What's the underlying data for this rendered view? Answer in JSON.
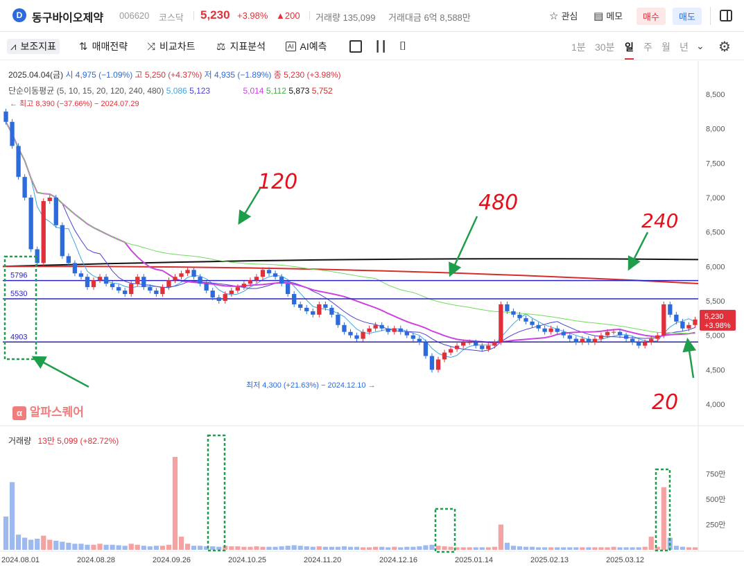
{
  "header": {
    "logo_letter": "D",
    "name": "동구바이오제약",
    "code": "006620",
    "market": "코스닥",
    "price": "5,230",
    "change_pct": "+3.98%",
    "change_abs": "▲200",
    "volume": "거래량 135,099",
    "amount": "거래대금 6억 8,588만",
    "watch_label": "관심",
    "memo_label": "메모",
    "buy_label": "매수",
    "sell_label": "매도"
  },
  "toolbar": {
    "indicator_label": "보조지표",
    "strategy_label": "매매전략",
    "compare_label": "비교차트",
    "analysis_label": "지표분석",
    "ai_label": "AI예측",
    "periods": [
      "1분",
      "30분",
      "일",
      "주",
      "월",
      "년"
    ],
    "selected_period": "일"
  },
  "chart_data": {
    "type": "candlestick",
    "ohlc_label": {
      "date": "2025.04.04(금)",
      "open": "시 4,975 (−1.09%)",
      "high": "고 5,250 (+4.37%)",
      "low": "저 4,935 (−1.89%)",
      "close": "종 5,230 (+3.98%)"
    },
    "ma_label": "단순이동평균 (5, 10, 15, 20, 120, 240, 480)",
    "ma_values": [
      {
        "period": 5,
        "value": "5,086",
        "color": "#3aa6e6"
      },
      {
        "period": 10,
        "value": "5,123",
        "color": "#4b3fd1"
      },
      {
        "period": 15,
        "value": "",
        "color": "#bbbbbb"
      },
      {
        "period": 20,
        "value": "5,014",
        "color": "#cc44dd"
      },
      {
        "period": 120,
        "value": "5,112",
        "color": "#5ad84a"
      },
      {
        "period": 240,
        "value": "5,873",
        "color": "#111111"
      },
      {
        "period": 480,
        "value": "5,752",
        "color": "#d62d2d"
      }
    ],
    "high_note": "← 최고 8,390 (−37.66%) − 2024.07.29",
    "low_note": "최저 4,300 (+21.63%) − 2024.12.10 →",
    "y_ticks": [
      "8,500",
      "8,000",
      "7,500",
      "7,000",
      "6,500",
      "6,000",
      "5,500",
      "5,000",
      "4,500",
      "4,000"
    ],
    "y_range": [
      4000,
      8500
    ],
    "x_ticks": [
      "2024.08.01",
      "2024.08.28",
      "2024.09.26",
      "2024.10.25",
      "2024.11.20",
      "2024.12.16",
      "2025.01.14",
      "2025.02.13",
      "2025.03.12"
    ],
    "last_price_badge": "5,230",
    "last_change_badge": "+3.98%",
    "horizontal_lines": [
      {
        "label": "5796",
        "value": 5796
      },
      {
        "label": "5530",
        "value": 5530
      },
      {
        "label": "4903",
        "value": 4903
      }
    ],
    "annotations": [
      "120",
      "480",
      "240",
      "20"
    ],
    "watermark": "알파스퀘어",
    "volume_label": "거래량",
    "volume_value": "13만 5,099 (+82.72%)",
    "volume_ticks": [
      "750만",
      "500만",
      "250만"
    ],
    "closes": [
      8100,
      7750,
      7300,
      7000,
      6250,
      6050,
      6950,
      7000,
      6600,
      6150,
      6050,
      5900,
      5850,
      5700,
      5800,
      5850,
      5750,
      5700,
      5650,
      5600,
      5750,
      5850,
      5700,
      5650,
      5600,
      5700,
      5800,
      5850,
      5900,
      5950,
      5850,
      5750,
      5650,
      5550,
      5500,
      5600,
      5650,
      5700,
      5750,
      5800,
      5850,
      5950,
      5900,
      5850,
      5750,
      5600,
      5450,
      5400,
      5350,
      5300,
      5450,
      5400,
      5300,
      5150,
      5050,
      5000,
      4950,
      5050,
      5100,
      5150,
      5100,
      5050,
      5100,
      5050,
      5000,
      4950,
      4900,
      4700,
      4500,
      4650,
      4750,
      4800,
      4850,
      4900,
      4900,
      4850,
      4800,
      4850,
      4900,
      5450,
      5350,
      5300,
      5250,
      5200,
      5150,
      5100,
      5050,
      5100,
      5050,
      5000,
      4950,
      4900,
      4950,
      4900,
      4950,
      5000,
      5050,
      5050,
      5000,
      4950,
      4900,
      4850,
      4900,
      4950,
      5000,
      5450,
      5300,
      5200,
      5100,
      5150,
      5230
    ],
    "volumes": [
      330,
      670,
      150,
      120,
      100,
      110,
      140,
      100,
      90,
      80,
      70,
      60,
      60,
      50,
      50,
      60,
      50,
      50,
      45,
      40,
      60,
      50,
      40,
      35,
      40,
      40,
      50,
      920,
      130,
      60,
      40,
      40,
      35,
      35,
      30,
      40,
      35,
      35,
      30,
      30,
      35,
      30,
      30,
      30,
      35,
      40,
      45,
      40,
      35,
      30,
      35,
      30,
      30,
      30,
      35,
      30,
      30,
      25,
      25,
      30,
      30,
      25,
      30,
      25,
      30,
      30,
      35,
      45,
      50,
      40,
      35,
      30,
      25,
      25,
      25,
      25,
      25,
      25,
      30,
      250,
      70,
      40,
      35,
      30,
      30,
      25,
      25,
      25,
      25,
      25,
      25,
      25,
      25,
      25,
      25,
      25,
      25,
      30,
      25,
      25,
      25,
      25,
      30,
      130,
      30,
      620,
      120,
      40,
      30,
      25,
      25
    ]
  }
}
